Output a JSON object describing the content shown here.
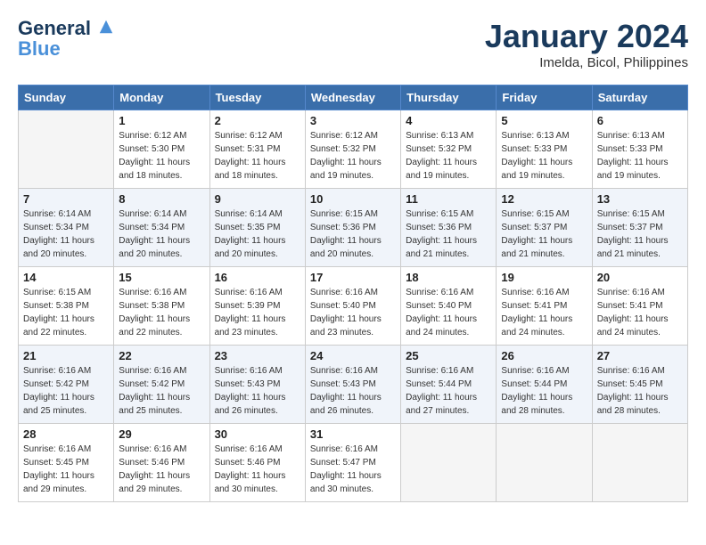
{
  "header": {
    "logo_line1": "General",
    "logo_line2": "Blue",
    "month": "January 2024",
    "location": "Imelda, Bicol, Philippines"
  },
  "days_of_week": [
    "Sunday",
    "Monday",
    "Tuesday",
    "Wednesday",
    "Thursday",
    "Friday",
    "Saturday"
  ],
  "weeks": [
    [
      {
        "day": "",
        "sunrise": "",
        "sunset": "",
        "daylight": ""
      },
      {
        "day": "1",
        "sunrise": "Sunrise: 6:12 AM",
        "sunset": "Sunset: 5:30 PM",
        "daylight": "Daylight: 11 hours and 18 minutes."
      },
      {
        "day": "2",
        "sunrise": "Sunrise: 6:12 AM",
        "sunset": "Sunset: 5:31 PM",
        "daylight": "Daylight: 11 hours and 18 minutes."
      },
      {
        "day": "3",
        "sunrise": "Sunrise: 6:12 AM",
        "sunset": "Sunset: 5:32 PM",
        "daylight": "Daylight: 11 hours and 19 minutes."
      },
      {
        "day": "4",
        "sunrise": "Sunrise: 6:13 AM",
        "sunset": "Sunset: 5:32 PM",
        "daylight": "Daylight: 11 hours and 19 minutes."
      },
      {
        "day": "5",
        "sunrise": "Sunrise: 6:13 AM",
        "sunset": "Sunset: 5:33 PM",
        "daylight": "Daylight: 11 hours and 19 minutes."
      },
      {
        "day": "6",
        "sunrise": "Sunrise: 6:13 AM",
        "sunset": "Sunset: 5:33 PM",
        "daylight": "Daylight: 11 hours and 19 minutes."
      }
    ],
    [
      {
        "day": "7",
        "sunrise": "Sunrise: 6:14 AM",
        "sunset": "Sunset: 5:34 PM",
        "daylight": "Daylight: 11 hours and 20 minutes."
      },
      {
        "day": "8",
        "sunrise": "Sunrise: 6:14 AM",
        "sunset": "Sunset: 5:34 PM",
        "daylight": "Daylight: 11 hours and 20 minutes."
      },
      {
        "day": "9",
        "sunrise": "Sunrise: 6:14 AM",
        "sunset": "Sunset: 5:35 PM",
        "daylight": "Daylight: 11 hours and 20 minutes."
      },
      {
        "day": "10",
        "sunrise": "Sunrise: 6:15 AM",
        "sunset": "Sunset: 5:36 PM",
        "daylight": "Daylight: 11 hours and 20 minutes."
      },
      {
        "day": "11",
        "sunrise": "Sunrise: 6:15 AM",
        "sunset": "Sunset: 5:36 PM",
        "daylight": "Daylight: 11 hours and 21 minutes."
      },
      {
        "day": "12",
        "sunrise": "Sunrise: 6:15 AM",
        "sunset": "Sunset: 5:37 PM",
        "daylight": "Daylight: 11 hours and 21 minutes."
      },
      {
        "day": "13",
        "sunrise": "Sunrise: 6:15 AM",
        "sunset": "Sunset: 5:37 PM",
        "daylight": "Daylight: 11 hours and 21 minutes."
      }
    ],
    [
      {
        "day": "14",
        "sunrise": "Sunrise: 6:15 AM",
        "sunset": "Sunset: 5:38 PM",
        "daylight": "Daylight: 11 hours and 22 minutes."
      },
      {
        "day": "15",
        "sunrise": "Sunrise: 6:16 AM",
        "sunset": "Sunset: 5:38 PM",
        "daylight": "Daylight: 11 hours and 22 minutes."
      },
      {
        "day": "16",
        "sunrise": "Sunrise: 6:16 AM",
        "sunset": "Sunset: 5:39 PM",
        "daylight": "Daylight: 11 hours and 23 minutes."
      },
      {
        "day": "17",
        "sunrise": "Sunrise: 6:16 AM",
        "sunset": "Sunset: 5:40 PM",
        "daylight": "Daylight: 11 hours and 23 minutes."
      },
      {
        "day": "18",
        "sunrise": "Sunrise: 6:16 AM",
        "sunset": "Sunset: 5:40 PM",
        "daylight": "Daylight: 11 hours and 24 minutes."
      },
      {
        "day": "19",
        "sunrise": "Sunrise: 6:16 AM",
        "sunset": "Sunset: 5:41 PM",
        "daylight": "Daylight: 11 hours and 24 minutes."
      },
      {
        "day": "20",
        "sunrise": "Sunrise: 6:16 AM",
        "sunset": "Sunset: 5:41 PM",
        "daylight": "Daylight: 11 hours and 24 minutes."
      }
    ],
    [
      {
        "day": "21",
        "sunrise": "Sunrise: 6:16 AM",
        "sunset": "Sunset: 5:42 PM",
        "daylight": "Daylight: 11 hours and 25 minutes."
      },
      {
        "day": "22",
        "sunrise": "Sunrise: 6:16 AM",
        "sunset": "Sunset: 5:42 PM",
        "daylight": "Daylight: 11 hours and 25 minutes."
      },
      {
        "day": "23",
        "sunrise": "Sunrise: 6:16 AM",
        "sunset": "Sunset: 5:43 PM",
        "daylight": "Daylight: 11 hours and 26 minutes."
      },
      {
        "day": "24",
        "sunrise": "Sunrise: 6:16 AM",
        "sunset": "Sunset: 5:43 PM",
        "daylight": "Daylight: 11 hours and 26 minutes."
      },
      {
        "day": "25",
        "sunrise": "Sunrise: 6:16 AM",
        "sunset": "Sunset: 5:44 PM",
        "daylight": "Daylight: 11 hours and 27 minutes."
      },
      {
        "day": "26",
        "sunrise": "Sunrise: 6:16 AM",
        "sunset": "Sunset: 5:44 PM",
        "daylight": "Daylight: 11 hours and 28 minutes."
      },
      {
        "day": "27",
        "sunrise": "Sunrise: 6:16 AM",
        "sunset": "Sunset: 5:45 PM",
        "daylight": "Daylight: 11 hours and 28 minutes."
      }
    ],
    [
      {
        "day": "28",
        "sunrise": "Sunrise: 6:16 AM",
        "sunset": "Sunset: 5:45 PM",
        "daylight": "Daylight: 11 hours and 29 minutes."
      },
      {
        "day": "29",
        "sunrise": "Sunrise: 6:16 AM",
        "sunset": "Sunset: 5:46 PM",
        "daylight": "Daylight: 11 hours and 29 minutes."
      },
      {
        "day": "30",
        "sunrise": "Sunrise: 6:16 AM",
        "sunset": "Sunset: 5:46 PM",
        "daylight": "Daylight: 11 hours and 30 minutes."
      },
      {
        "day": "31",
        "sunrise": "Sunrise: 6:16 AM",
        "sunset": "Sunset: 5:47 PM",
        "daylight": "Daylight: 11 hours and 30 minutes."
      },
      {
        "day": "",
        "sunrise": "",
        "sunset": "",
        "daylight": ""
      },
      {
        "day": "",
        "sunrise": "",
        "sunset": "",
        "daylight": ""
      },
      {
        "day": "",
        "sunrise": "",
        "sunset": "",
        "daylight": ""
      }
    ]
  ]
}
